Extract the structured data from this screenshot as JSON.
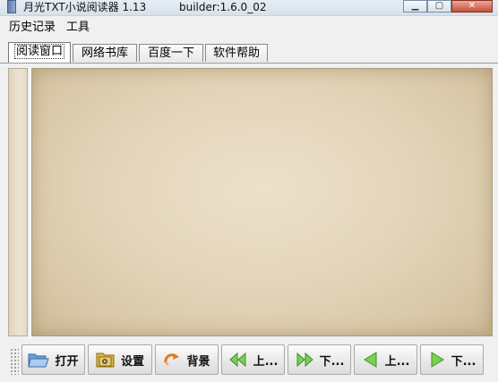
{
  "window": {
    "title": "月光TXT小说阅读器 1.13",
    "build": "builder:1.6.0_02",
    "minimize": "▁",
    "maximize": "▢",
    "close": "✕"
  },
  "menubar": {
    "items": [
      "历史记录",
      "工具"
    ]
  },
  "tabs": {
    "items": [
      "阅读窗口",
      "网络书库",
      "百度一下",
      "软件帮助"
    ],
    "active": 0
  },
  "toolbar": {
    "open": "打开",
    "settings": "设置",
    "background": "背景",
    "prev_chapter": "上...",
    "next_chapter": "下...",
    "prev_page": "上...",
    "next_page": "下..."
  },
  "icons": {
    "open": "folder-open-icon",
    "settings": "gear-folder-icon",
    "background": "refresh-arrow-icon",
    "prev_chapter": "double-left-arrow-icon",
    "next_chapter": "double-right-arrow-icon",
    "prev_page": "left-arrow-icon",
    "next_page": "right-arrow-icon"
  },
  "colors": {
    "paper": "#e4d6bb",
    "arrow_green": "#6cc24a",
    "arrow_orange": "#e07a1c"
  }
}
